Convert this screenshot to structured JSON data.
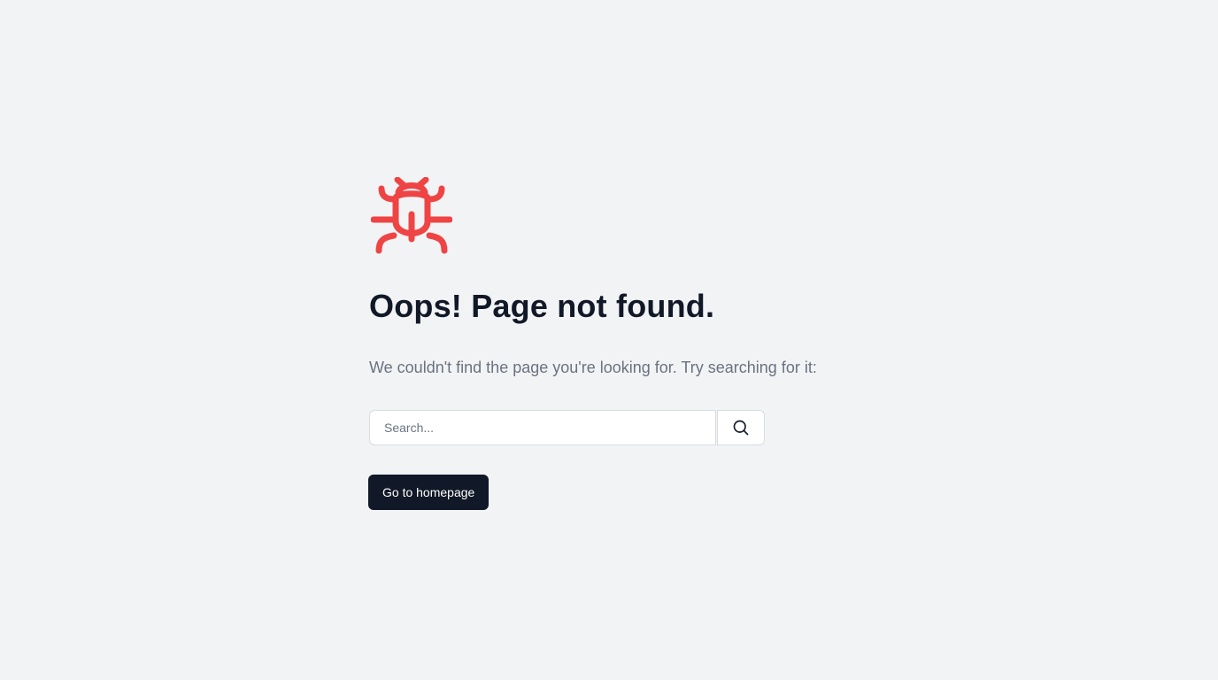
{
  "colors": {
    "background": "#f2f3f5",
    "accent_icon": "#ef4444",
    "heading": "#111827",
    "muted_text": "#6b7280",
    "button_bg": "#111827",
    "button_text": "#ffffff"
  },
  "icons": {
    "main": "bug-icon",
    "search": "search-icon"
  },
  "error": {
    "title": "Oops! Page not found.",
    "message": "We couldn't find the page you're looking for. Try searching for it:"
  },
  "search": {
    "placeholder": "Search...",
    "value": ""
  },
  "actions": {
    "home_label": "Go to homepage"
  }
}
